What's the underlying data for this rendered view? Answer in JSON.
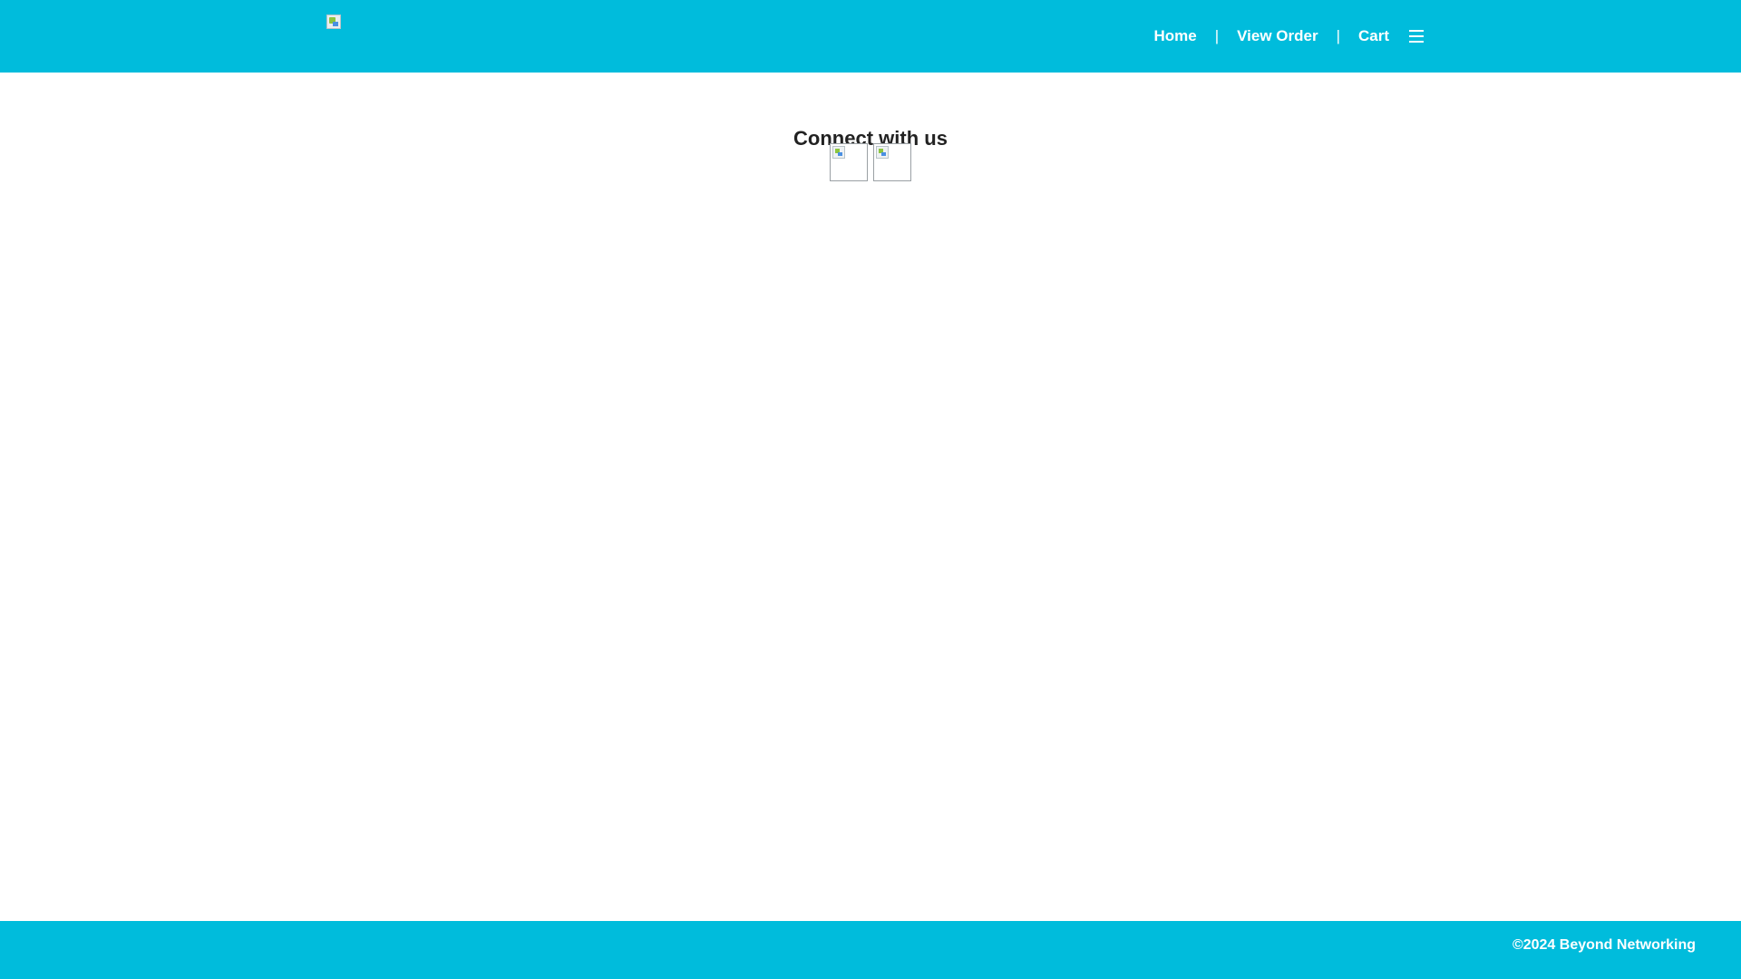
{
  "header": {
    "logo_icon": "broken-image-icon",
    "nav": {
      "home": "Home",
      "separator1": "|",
      "view_order": "View Order",
      "separator2": "|",
      "cart": "Cart",
      "menu_icon": "hamburger-menu-icon"
    }
  },
  "main": {
    "connect_title": "Connect with us",
    "social_links": [
      {
        "icon": "broken-image-icon"
      },
      {
        "icon": "broken-image-icon"
      }
    ]
  },
  "footer": {
    "copyright": "©2024 Beyond Networking"
  },
  "colors": {
    "brand": "#00bcdc",
    "background": "#ffffff",
    "text_dark": "#222222",
    "text_light": "#ffffff"
  }
}
